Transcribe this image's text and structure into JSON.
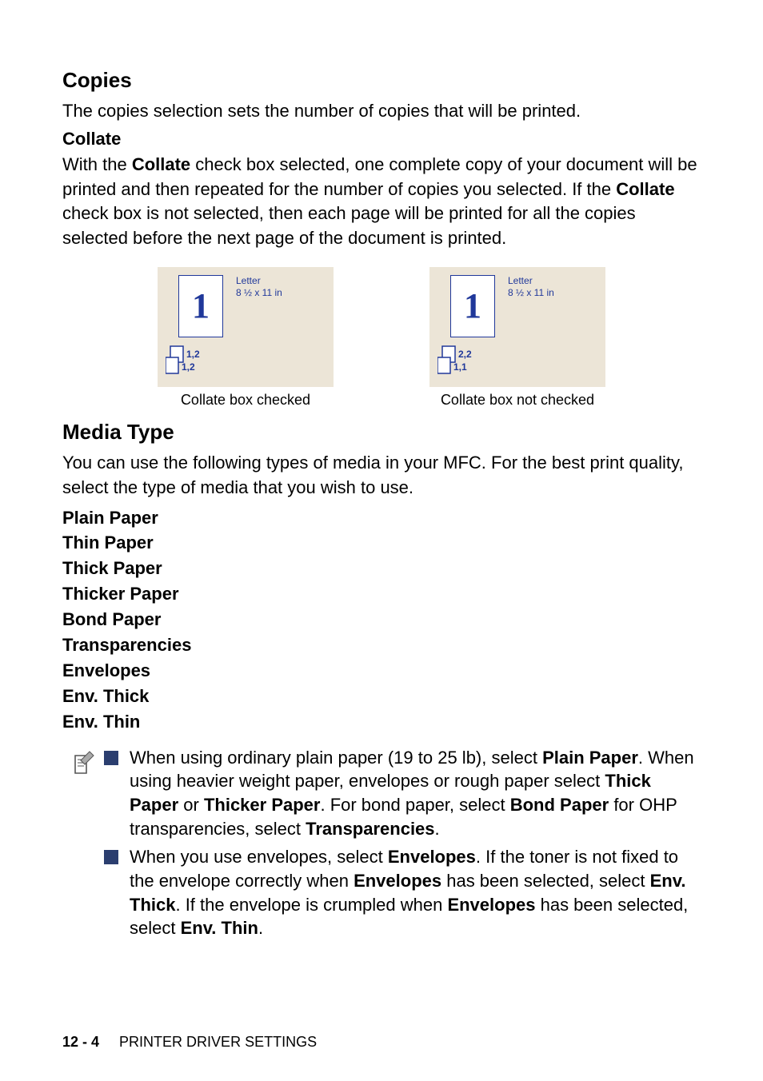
{
  "copies": {
    "heading": "Copies",
    "desc": "The copies selection sets the number of copies that will be printed."
  },
  "collate": {
    "heading": "Collate",
    "desc_parts": {
      "p1": "With the ",
      "b1": "Collate",
      "p2": " check box selected, one complete copy of your document will be printed and then repeated for the number of copies you selected. If the ",
      "b2": "Collate",
      "p3": " check box is not selected, then each page will be printed for all the copies selected before the next page of the document is printed."
    },
    "illustrations": {
      "paper_name": "Letter",
      "paper_size": "8 ½ x 11 in",
      "page_digit": "1",
      "checked": {
        "stack_top": "1,2",
        "stack_bottom": "1,2",
        "caption": "Collate box checked"
      },
      "unchecked": {
        "stack_top": "2,2",
        "stack_bottom": "1,1",
        "caption": "Collate box not checked"
      }
    }
  },
  "media": {
    "heading": "Media Type",
    "desc": "You can use the following types of media in your MFC.  For the best print quality, select the type of media that you wish to use.",
    "types": {
      "t0": "Plain Paper",
      "t1": "Thin Paper",
      "t2": "Thick Paper",
      "t3": "Thicker Paper",
      "t4": "Bond Paper",
      "t5": "Transparencies",
      "t6": "Envelopes",
      "t7": "Env. Thick",
      "t8": "Env. Thin"
    },
    "note1": {
      "s1": "When using ordinary plain paper (19 to 25 lb), select ",
      "b1": "Plain Paper",
      "s2": ". When using heavier weight paper, envelopes or rough paper select ",
      "b2": "Thick Paper",
      "s3": " or ",
      "b3": "Thicker Paper",
      "s4": ". For bond paper, select ",
      "b4": "Bond Paper",
      "s5": " for OHP transparencies, select ",
      "b5": "Transparencies",
      "s6": "."
    },
    "note2": {
      "s1": "When you use envelopes, select ",
      "b1": "Envelopes",
      "s2": ". If the toner is not fixed to the envelope correctly when ",
      "b2": "Envelopes",
      "s3": " has been selected, select ",
      "b3": "Env. Thick",
      "s4": ". If the envelope is crumpled when ",
      "b4": "Envelopes",
      "s5": " has been selected, select ",
      "b5": "Env. Thin",
      "s6": "."
    }
  },
  "footer": {
    "page": "12 - 4",
    "section": "PRINTER DRIVER SETTINGS"
  }
}
